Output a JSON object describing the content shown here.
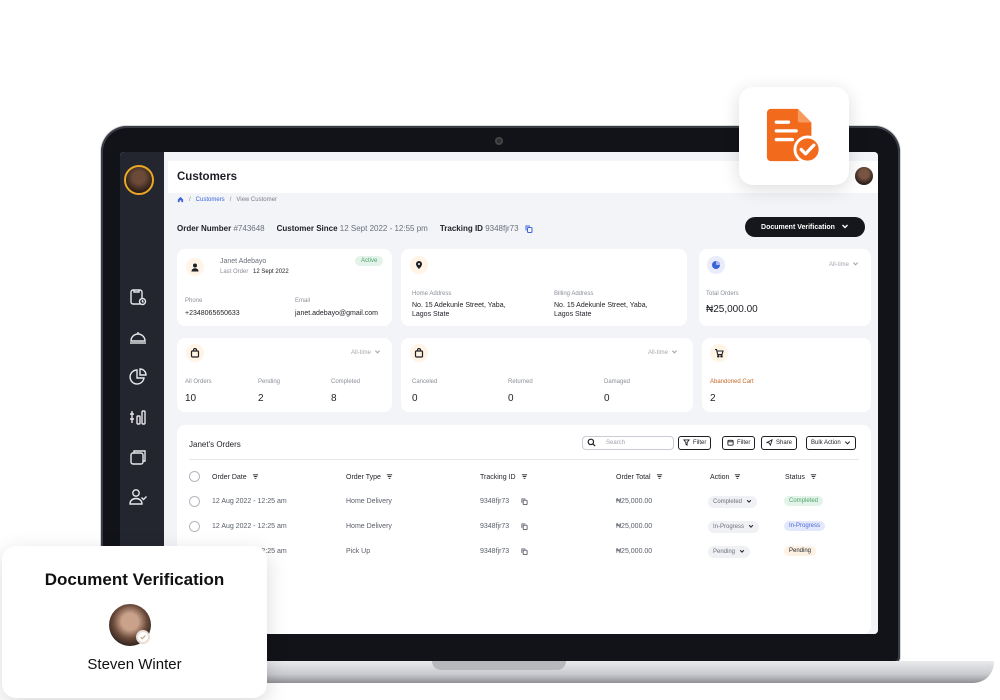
{
  "app": {
    "page_title": "Customers",
    "breadcrumb": [
      "Customers",
      "View Customer"
    ]
  },
  "order_meta": {
    "order_number_label": "Order Number",
    "order_number": "#743648",
    "customer_since_label": "Customer Since",
    "customer_since": "12 Sept 2022 - 12:55 pm",
    "tracking_id_label": "Tracking ID",
    "tracking_id": "9348fjr73",
    "document_button": "Document Verification"
  },
  "customer_card": {
    "name": "Janet Adebayo",
    "last_order_label": "Last Order",
    "last_order": "12 Sept 2022",
    "status": "Active",
    "phone_label": "Phone",
    "phone": "+2348065650633",
    "email_label": "Email",
    "email": "janet.adebayo@gmail.com"
  },
  "address_card": {
    "home_label": "Home Address",
    "home_line1": "No. 15 Adekunle Street, Yaba,",
    "home_line2": "Lagos State",
    "billing_label": "Billing Address",
    "billing_line1": "No. 15 Adekunle Street, Yaba,",
    "billing_line2": "Lagos State"
  },
  "total_orders_card": {
    "filter": "All-time",
    "label": "Total Orders",
    "value": "₦25,000.00"
  },
  "orders_summary": {
    "filter": "All-time",
    "all_label": "All Orders",
    "all_value": "10",
    "pending_label": "Pending",
    "pending_value": "2",
    "completed_label": "Completed",
    "completed_value": "8"
  },
  "returns_summary": {
    "filter": "All-time",
    "canceled_label": "Canceled",
    "canceled_value": "0",
    "returned_label": "Returned",
    "returned_value": "0",
    "damaged_label": "Damaged",
    "damaged_value": "0"
  },
  "cart_summary": {
    "label": "Abandoned Cart",
    "value": "2"
  },
  "orders_table": {
    "title": "Janet's Orders",
    "search_placeholder": "Search",
    "filter_label": "Filter",
    "filter2_label": "Filter",
    "share_label": "Share",
    "bulk_label": "Bulk Action",
    "columns": [
      "Order Date",
      "Order Type",
      "Tracking ID",
      "Order Total",
      "Action",
      "Status"
    ],
    "rows": [
      {
        "date": "12 Aug 2022 - 12:25 am",
        "type": "Home Delivery",
        "tracking": "9348fjr73",
        "total": "₦25,000.00",
        "action": "Completed",
        "status": "Completed"
      },
      {
        "date": "12 Aug 2022 - 12:25 am",
        "type": "Home Delivery",
        "tracking": "9348fjr73",
        "total": "₦25,000.00",
        "action": "In-Progress",
        "status": "In-Progress"
      },
      {
        "date": "12 Aug 2022 - 12:25 am",
        "type": "Pick Up",
        "tracking": "9348fjr73",
        "total": "₦25,000.00",
        "action": "Pending",
        "status": "Pending"
      }
    ]
  },
  "verification": {
    "title": "Document Verification",
    "name": "Steven Winter"
  },
  "icons": {
    "floating": "document-check-icon",
    "sidebar": [
      "orders-icon",
      "cloche-icon",
      "pie-chart-icon",
      "finance-chart-icon",
      "folders-icon",
      "users-icon"
    ]
  },
  "colors": {
    "accent_orange": "#f26b1d",
    "sidebar_bg": "#23262f",
    "primary_blue": "#3b64d8",
    "active_badge_bg": "#e3f3e9",
    "active_badge_text": "#4fa36b",
    "inprogress_bg": "#e3e8fb",
    "inprogress_text": "#4d6ad8",
    "pending_bg": "#fdf1e3",
    "pending_text": "#1d1f25"
  }
}
